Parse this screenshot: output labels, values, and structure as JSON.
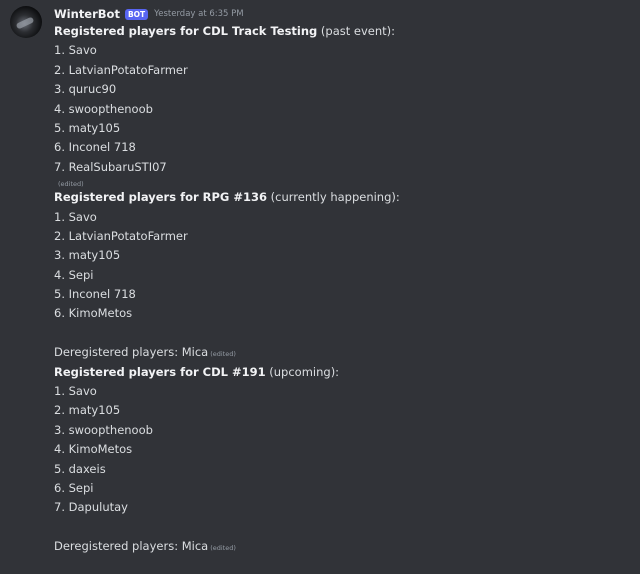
{
  "author": {
    "name": "WinterBot",
    "tag": "BOT",
    "timestamp": "Yesterday at 6:35 PM"
  },
  "edited_label": "(edited)",
  "sections": [
    {
      "bold": "Registered players for CDL Track Testing",
      "rest": " (past event):",
      "players": [
        "1. Savo",
        "2. LatvianPotatoFarmer",
        "3. quruc90",
        "4. swoopthenoob",
        "5. maty105",
        "6. Inconel 718",
        "7. RealSubaruSTI07"
      ]
    },
    {
      "bold": "Registered players for RPG #136",
      "rest": " (currently happening):",
      "players": [
        "1. Savo",
        "2. LatvianPotatoFarmer",
        "3. maty105",
        "4. Sepi",
        "5. Inconel 718",
        "6. KimoMetos"
      ],
      "deregistered": "Deregistered players: Mica"
    },
    {
      "bold": "Registered players for CDL #191",
      "rest": " (upcoming):",
      "players": [
        "1. Savo",
        "2. maty105",
        "3. swoopthenoob",
        "4. KimoMetos",
        "5. daxeis",
        "6. Sepi",
        "7. Dapulutay"
      ],
      "deregistered": "Deregistered players: Mica"
    }
  ]
}
